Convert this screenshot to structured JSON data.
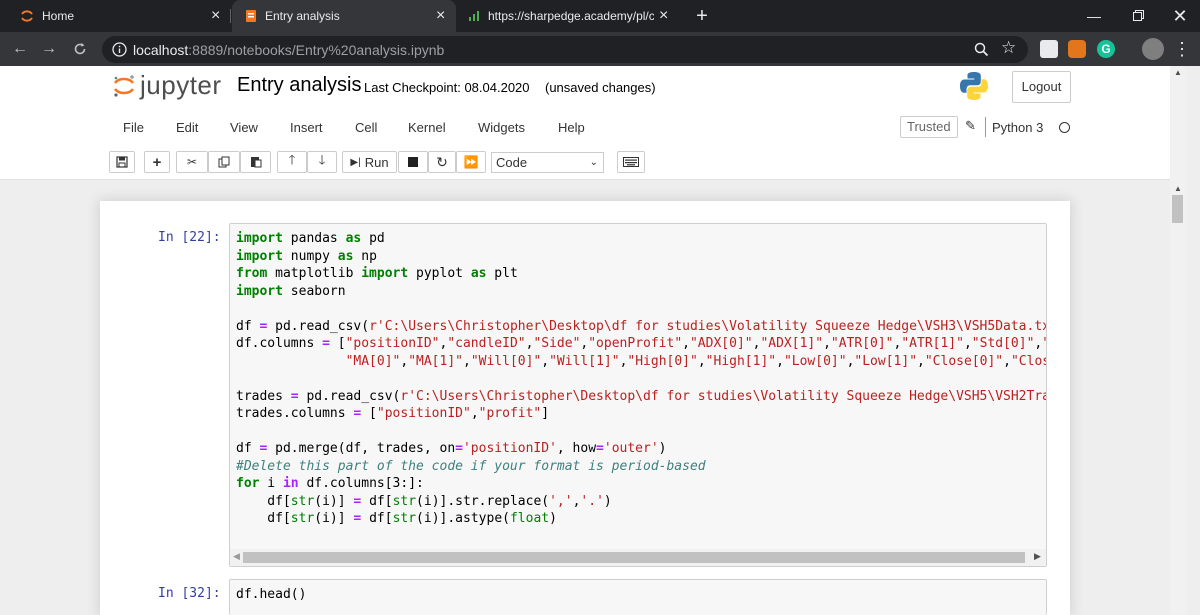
{
  "browser": {
    "tabs": [
      {
        "title": "Home"
      },
      {
        "title": "Entry analysis"
      },
      {
        "title": "https://sharpedge.academy/pl/cr"
      }
    ],
    "new_tab_symbol": "+",
    "url_host": "localhost",
    "url_path": ":8889/notebooks/Entry%20analysis.ipynb"
  },
  "jupyter": {
    "logo": "jupyter",
    "notebook_name": "Entry analysis",
    "checkpoint": "Last Checkpoint: 08.04.2020",
    "unsaved": "(unsaved changes)",
    "logout": "Logout",
    "menu": [
      "File",
      "Edit",
      "View",
      "Insert",
      "Cell",
      "Kernel",
      "Widgets",
      "Help"
    ],
    "trusted": "Trusted",
    "kernel": "Python 3",
    "run_label": "Run",
    "cell_type": "Code"
  },
  "cells": [
    {
      "prompt": "In [22]:"
    },
    {
      "prompt": "In [32]:",
      "code": "df.head()"
    }
  ],
  "colors": {
    "prompt": "#303f9f",
    "keyword": "#008000",
    "string": "#ba2121",
    "comment": "#408080"
  }
}
